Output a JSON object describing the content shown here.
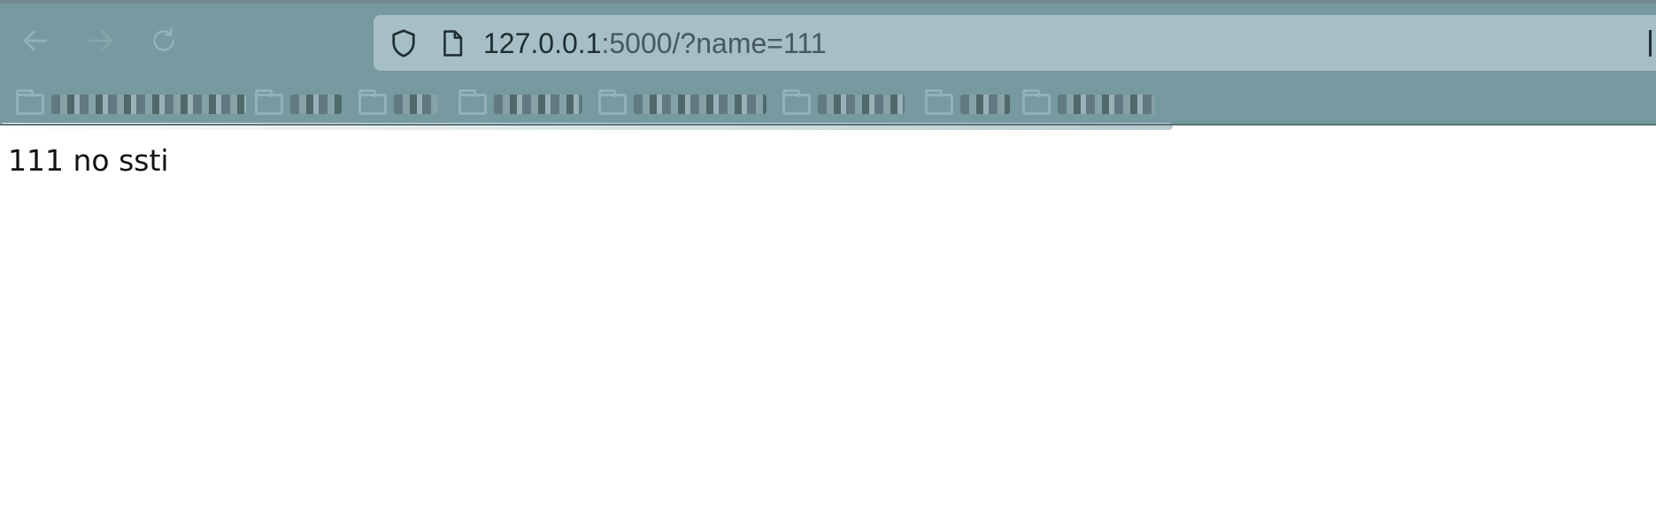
{
  "toolbar": {
    "back_icon": "arrow-left-icon",
    "forward_icon": "arrow-right-icon",
    "reload_icon": "reload-icon"
  },
  "address_bar": {
    "host": "127.0.0.1",
    "rest": ":5000/?name=111"
  },
  "bookmarks": [
    {
      "icon": "folder-icon"
    },
    {
      "icon": "folder-icon"
    },
    {
      "icon": "folder-icon"
    },
    {
      "icon": "folder-icon"
    },
    {
      "icon": "folder-icon"
    },
    {
      "icon": "folder-icon"
    },
    {
      "icon": "folder-icon"
    },
    {
      "icon": "folder-icon"
    }
  ],
  "page": {
    "body_text": "111 no ssti"
  },
  "colors": {
    "chrome_bg": "#7799a0",
    "urlbar_bg": "#a6bfc4",
    "icon_tint": "#8fb3ba"
  }
}
